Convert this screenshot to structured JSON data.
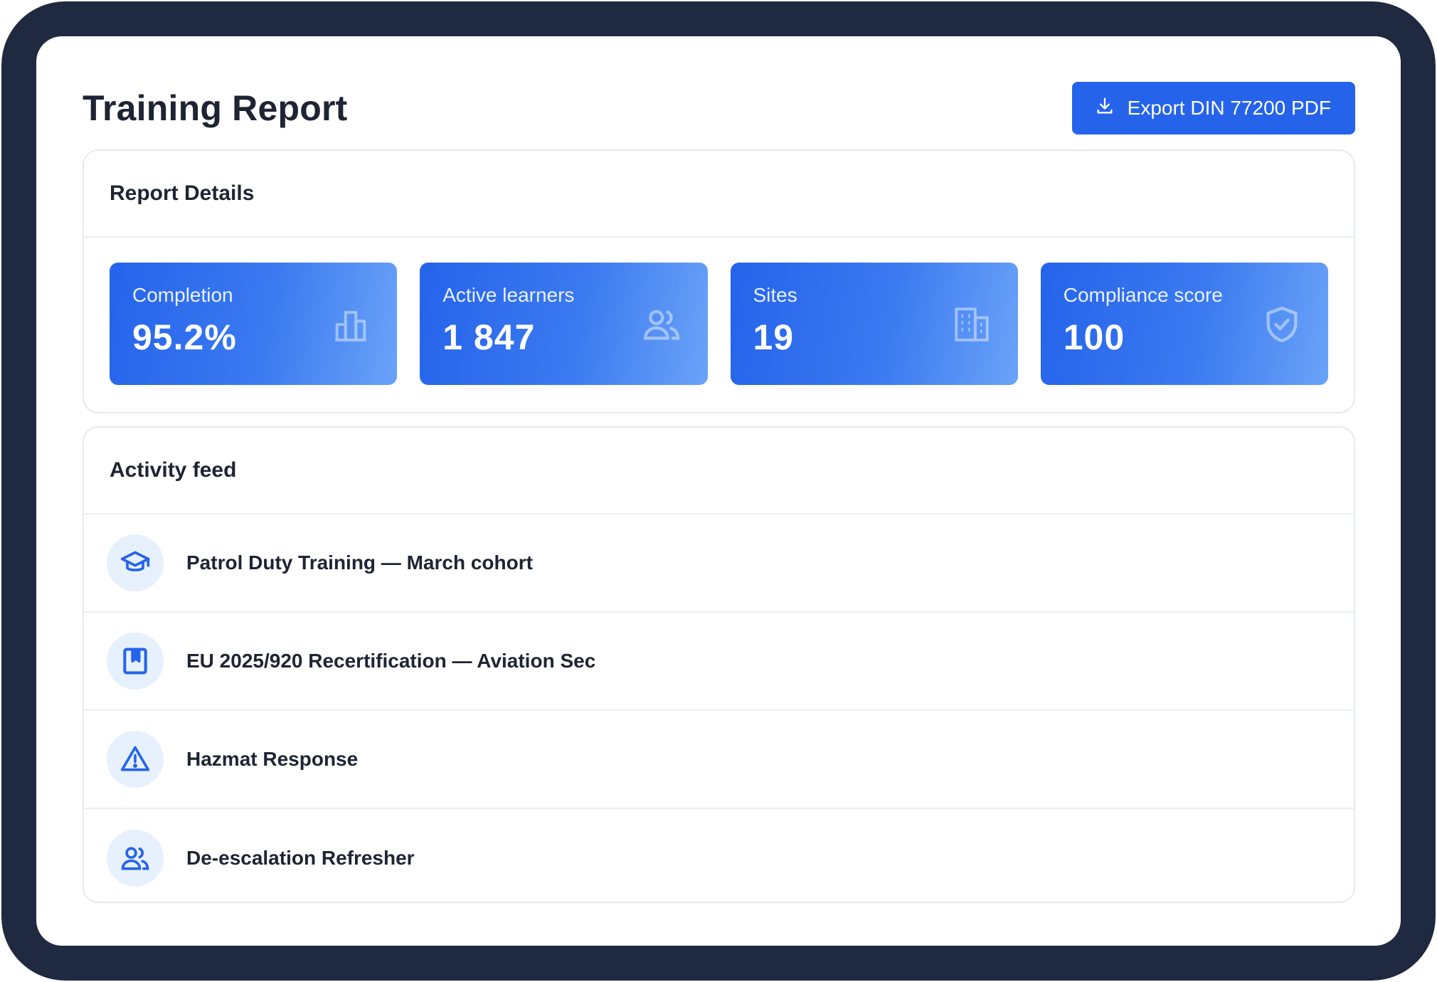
{
  "header": {
    "title": "Training Report",
    "export_label": "Export DIN 77200 PDF",
    "export_icon": "download-icon"
  },
  "details": {
    "title": "Report Details",
    "stats": [
      {
        "label": "Completion",
        "value": "95.2%",
        "icon": "bar-chart-icon"
      },
      {
        "label": "Active learners",
        "value": "1 847",
        "icon": "users-icon"
      },
      {
        "label": "Sites",
        "value": "19",
        "icon": "building-icon"
      },
      {
        "label": "Compliance score",
        "value": "100",
        "icon": "shield-check-icon"
      }
    ]
  },
  "activity": {
    "title": "Activity feed",
    "items": [
      {
        "text": "Patrol Duty Training — March cohort",
        "icon": "graduation-cap-icon"
      },
      {
        "text": "EU 2025/920 Recertification — Aviation Sec",
        "icon": "bookmark-book-icon"
      },
      {
        "text": "Hazmat Response",
        "icon": "warning-triangle-icon"
      },
      {
        "text": "De-escalation Refresher",
        "icon": "users-icon"
      }
    ]
  },
  "colors": {
    "frame": "#1f2940",
    "accent": "#2563eb",
    "icon_bg": "#e6f1fd",
    "text": "#1e2433"
  }
}
